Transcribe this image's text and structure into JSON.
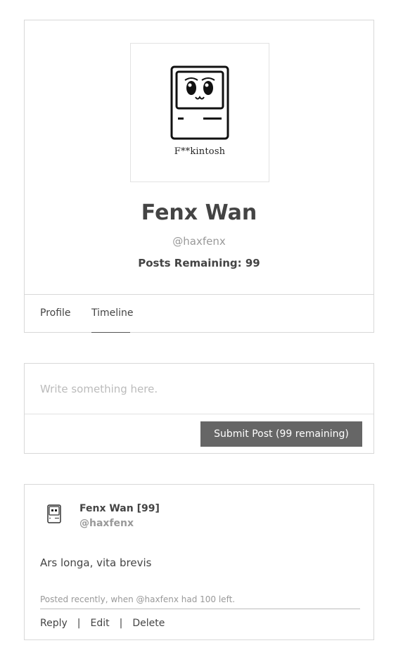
{
  "profile": {
    "avatar_caption": "F**kintosh",
    "name": "Fenx Wan",
    "handle": "@haxfenx",
    "posts_remaining": "Posts Remaining: 99"
  },
  "tabs": [
    {
      "label": "Profile",
      "active": false
    },
    {
      "label": "Timeline",
      "active": true
    }
  ],
  "composer": {
    "placeholder": "Write something here.",
    "submit_label": "Submit Post (99 remaining)"
  },
  "post": {
    "author": "Fenx Wan [99]",
    "handle": "@haxfenx",
    "body": "Ars longa, vita brevis",
    "meta": "Posted recently, when @haxfenx had 100 left.",
    "actions": {
      "reply": "Reply",
      "edit": "Edit",
      "delete": "Delete",
      "separator": "|"
    }
  }
}
